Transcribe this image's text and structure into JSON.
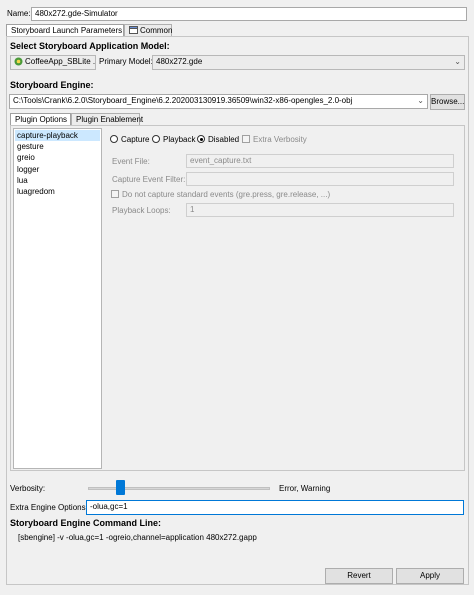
{
  "name": {
    "label": "Name:",
    "value": "480x272.gde-Simulator"
  },
  "tabs": [
    {
      "label": "Storyboard Launch Parameters",
      "selected": true
    },
    {
      "label": "Common",
      "selected": false
    }
  ],
  "app_model": {
    "heading": "Select Storyboard Application Model:",
    "project_value": "CoffeeApp_SBLite ...",
    "primary_label": "Primary Model:",
    "primary_value": "480x272.gde"
  },
  "engine": {
    "heading": "Storyboard Engine:",
    "path": "C:\\Tools\\Crank\\6.2.0\\Storyboard_Engine\\6.2.202003130919.36509\\win32-x86-opengles_2.0-obj",
    "browse_label": "Browse..."
  },
  "plugin_tabs": [
    {
      "label": "Plugin Options",
      "selected": true
    },
    {
      "label": "Plugin Enablement",
      "selected": false
    }
  ],
  "plugins": [
    "capture-playback",
    "gesture",
    "greio",
    "logger",
    "lua",
    "luagredom"
  ],
  "selected_plugin": "capture-playback",
  "capture": {
    "mode_options": [
      "Capture",
      "Playback",
      "Disabled"
    ],
    "selected_mode": "Disabled",
    "extra_verbosity_label": "Extra Verbosity",
    "event_file_label": "Event File:",
    "event_file_value": "event_capture.txt",
    "capture_filter_label": "Capture Event Filter:",
    "capture_filter_value": "",
    "no_standard_events_label": "Do not capture standard events (gre.press, gre.release, ...)",
    "playback_loops_label": "Playback Loops:",
    "playback_loops_value": "1"
  },
  "verbosity": {
    "label": "Verbosity:",
    "level_text": "Error, Warning",
    "level_fraction": 0.16
  },
  "extra_options": {
    "label": "Extra Engine Options:",
    "value": "-olua,gc=1"
  },
  "command": {
    "heading": "Storyboard Engine Command Line:",
    "text": "[sbengine] -v -olua,gc=1 -ogreio,channel=application 480x272.gapp"
  },
  "buttons": {
    "revert": "Revert",
    "apply": "Apply"
  }
}
